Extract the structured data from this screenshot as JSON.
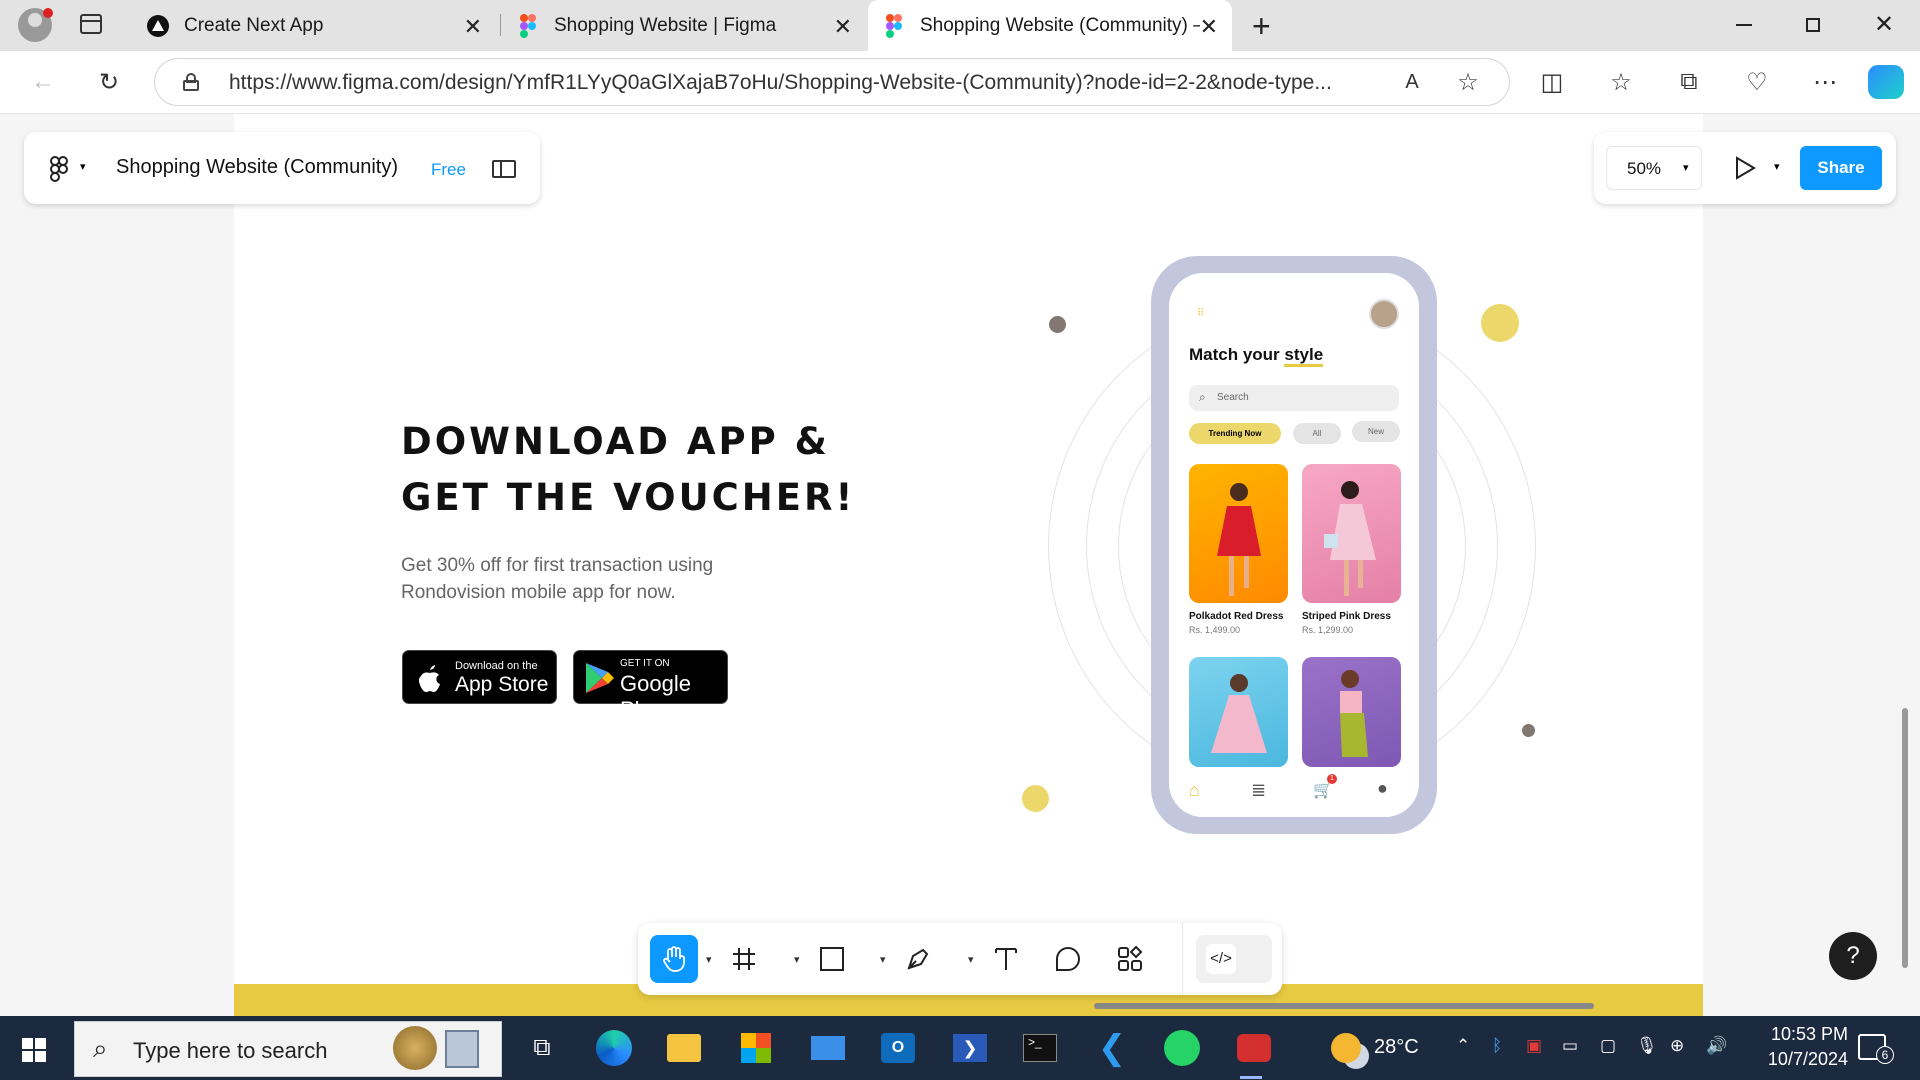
{
  "browser": {
    "tabs": [
      {
        "title": "Create Next App"
      },
      {
        "title": "Shopping Website | Figma"
      },
      {
        "title": "Shopping Website (Community) –"
      }
    ],
    "url": "https://www.figma.com/design/YmfR1LYyQ0aGlXajaB7oHu/Shopping-Website-(Community)?node-id=2-2&node-type..."
  },
  "figma": {
    "file_title": "Shopping Website (Community)",
    "plan_badge": "Free",
    "zoom": "50%",
    "share_label": "Share",
    "help_label": "?"
  },
  "design": {
    "heading_line1": "DOWNLOAD APP &",
    "heading_line2": "GET THE VOUCHER!",
    "subtext": "Get 30% off for first transaction using Rondovision mobile app for now.",
    "appstore_small": "Download on the",
    "appstore_big": "App Store",
    "googleplay_small": "GET IT ON",
    "googleplay_big": "Google Play",
    "phone": {
      "title_plain": "Match your ",
      "title_underlined": "style",
      "search_placeholder": "Search",
      "filters": [
        "Trending Now",
        "All",
        "New"
      ],
      "products": [
        {
          "name": "Polkadot Red Dress",
          "price": "Rs. 1,499.00"
        },
        {
          "name": "Striped Pink Dress",
          "price": "Rs. 1,299.00"
        }
      ],
      "cart_badge": "1"
    }
  },
  "taskbar": {
    "search_placeholder": "Type here to search",
    "weather": "28°C",
    "time": "10:53 PM",
    "date": "10/7/2024",
    "notification_count": "6"
  },
  "colors": {
    "accent_yellow": "#e8c942",
    "figma_blue": "#0d99ff",
    "phone_frame": "#c3c7dd",
    "taskbar": "#1c2a3f"
  }
}
